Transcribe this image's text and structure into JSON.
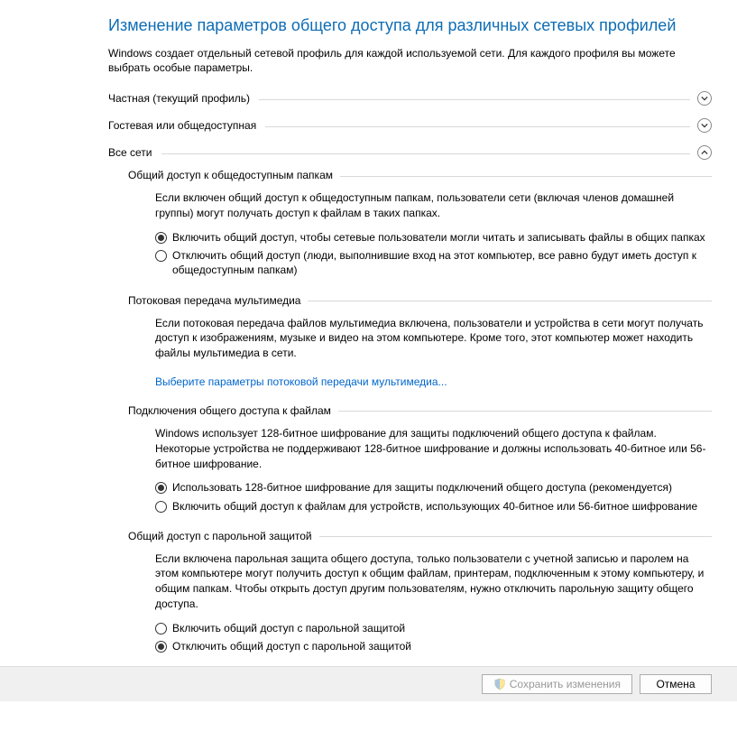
{
  "title": "Изменение параметров общего доступа для различных сетевых профилей",
  "intro": "Windows создает отдельный сетевой профиль для каждой используемой сети. Для каждого профиля вы можете выбрать особые параметры.",
  "profiles": {
    "private": {
      "label": "Частная (текущий профиль)",
      "expanded": false
    },
    "guest": {
      "label": "Гостевая или общедоступная",
      "expanded": false
    },
    "all": {
      "label": "Все сети",
      "expanded": true
    }
  },
  "all_networks": {
    "public_folders": {
      "header": "Общий доступ к общедоступным папкам",
      "desc": "Если включен общий доступ к общедоступным папкам, пользователи сети (включая членов домашней группы) могут получать доступ к файлам в таких папках.",
      "options": {
        "on": "Включить общий доступ, чтобы сетевые пользователи могли читать и записывать файлы в общих папках",
        "off": "Отключить общий доступ (люди, выполнившие вход на этот компьютер, все равно будут иметь доступ к общедоступным папкам)"
      },
      "selected": "on"
    },
    "media_streaming": {
      "header": "Потоковая передача мультимедиа",
      "desc": "Если потоковая передача файлов мультимедиа включена, пользователи и устройства в сети могут получать доступ к изображениям, музыке и видео на этом компьютере. Кроме того, этот компьютер может находить файлы мультимедиа в сети.",
      "link": "Выберите параметры потоковой передачи мультимедиа..."
    },
    "file_connections": {
      "header": "Подключения общего доступа к файлам",
      "desc": "Windows использует 128-битное шифрование для защиты подключений общего доступа к файлам. Некоторые устройства не поддерживают 128-битное шифрование и должны использовать 40-битное или 56-битное шифрование.",
      "options": {
        "enc128": "Использовать 128-битное шифрование для защиты подключений общего доступа (рекомендуется)",
        "enc40": "Включить общий доступ к файлам для устройств, использующих 40-битное или 56-битное шифрование"
      },
      "selected": "enc128"
    },
    "password": {
      "header": "Общий доступ с парольной защитой",
      "desc": "Если включена парольная защита общего доступа, только пользователи с учетной записью и паролем на этом компьютере могут получить доступ к общим файлам, принтерам, подключенным к этому компьютеру, и общим папкам. Чтобы открыть доступ другим пользователям, нужно отключить парольную защиту общего доступа.",
      "options": {
        "on": "Включить общий доступ с парольной защитой",
        "off": "Отключить общий доступ с парольной защитой"
      },
      "selected": "off"
    }
  },
  "buttons": {
    "save": "Сохранить изменения",
    "cancel": "Отмена"
  }
}
